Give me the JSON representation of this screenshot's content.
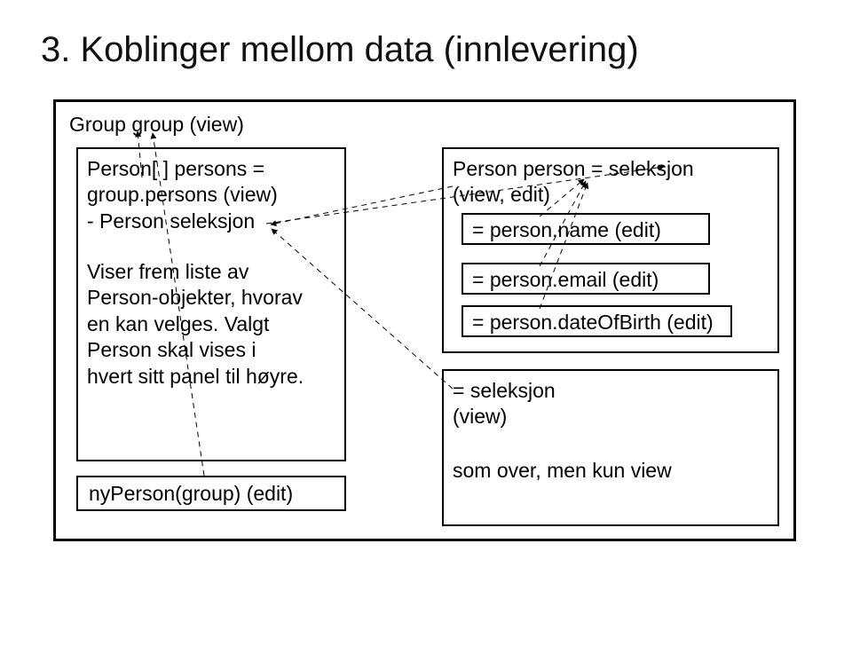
{
  "title": "3. Koblinger mellom data (innlevering)",
  "outer": {
    "group_label": "Group group (view)",
    "persons_decl": "Person[ ] persons =\ngroup.persons (view)\n- Person seleksjon",
    "list_explain": "Viser frem liste av\nPerson-objekter, hvorav\nen kan velges. Valgt\nPerson skal vises i\nhvert sitt panel til høyre.",
    "nyperson": "nyPerson(group) (edit)",
    "person_decl": "Person person = seleksjon\n(view, edit)",
    "name_field": "= person.name (edit)",
    "email_field": "= person.email (edit)",
    "dob_field": "= person.dateOfBirth (edit)",
    "sel_view": "= seleksjon\n(view)",
    "som_over": "som over, men kun view"
  }
}
